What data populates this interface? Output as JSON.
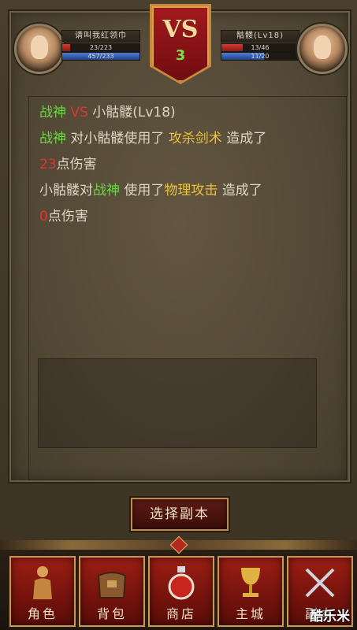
{
  "header": {
    "vs_label": "VS",
    "round": "3",
    "player": {
      "name": "请叫我红领巾",
      "hp_text": "23/223",
      "mp_text": "457/233",
      "hp_fraction": 0.1,
      "mp_fraction": 1.0
    },
    "enemy": {
      "name": "骷髅(Lv18)",
      "hp_text": "13/46",
      "mp_text": "11/20",
      "hp_fraction": 0.28,
      "mp_fraction": 0.55
    }
  },
  "log": {
    "title": {
      "a": "战神",
      "vs": "VS",
      "b": "小骷髅(Lv18)"
    },
    "line1": {
      "actor": "战神",
      "mid": "对小骷髅使用了",
      "skill": "攻杀剑术",
      "tail": "造成了"
    },
    "line2": {
      "damage": "23",
      "tail": "点伤害"
    },
    "line3": {
      "actor": "小骷髅对",
      "target": "战神",
      "mid": "使用了",
      "skill": "物理攻击",
      "tail": "造成了"
    },
    "line4": {
      "damage": "0",
      "tail": "点伤害"
    }
  },
  "action": {
    "select_label": "选择副本"
  },
  "nav": {
    "items": [
      {
        "label": "角色",
        "icon": "character-icon"
      },
      {
        "label": "背包",
        "icon": "bag-icon"
      },
      {
        "label": "商店",
        "icon": "potion-icon"
      },
      {
        "label": "主城",
        "icon": "chalice-icon"
      },
      {
        "label": "副本",
        "icon": "swords-icon"
      }
    ]
  },
  "watermark": "酷乐米",
  "colors": {
    "green": "#6cd646",
    "red": "#e23434",
    "yellow": "#e8c23a"
  }
}
